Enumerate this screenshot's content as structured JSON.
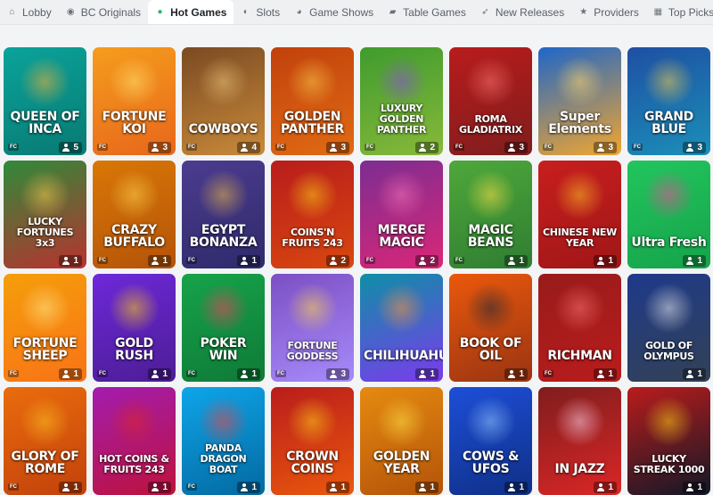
{
  "nav": {
    "items": [
      {
        "label": "Lobby",
        "icon": "home-icon",
        "glyph": "⌂",
        "active": false
      },
      {
        "label": "BC Originals",
        "icon": "bc-logo-icon",
        "glyph": "◉",
        "active": false
      },
      {
        "label": "Hot Games",
        "icon": "flame-icon",
        "glyph": "●",
        "active": true
      },
      {
        "label": "Slots",
        "icon": "slots-icon",
        "glyph": "◐",
        "active": false
      },
      {
        "label": "Game Shows",
        "icon": "game-shows-icon",
        "glyph": "◕",
        "active": false
      },
      {
        "label": "Table Games",
        "icon": "cards-icon",
        "glyph": "▰",
        "active": false
      },
      {
        "label": "New Releases",
        "icon": "rocket-icon",
        "glyph": "➶",
        "active": false
      },
      {
        "label": "Providers",
        "icon": "star-icon",
        "glyph": "★",
        "active": false
      },
      {
        "label": "Top Picks",
        "icon": "grid-icon",
        "glyph": "▦",
        "active": false
      },
      {
        "label": "",
        "icon": "more-icon",
        "glyph": "◈",
        "active": false
      }
    ]
  },
  "colors": {
    "accent": "#2bb673",
    "background": "#f3f4f6"
  },
  "games": [
    {
      "title": "QUEEN OF INCA",
      "provider": "FC",
      "players": "5",
      "bg": [
        "#0aa39a",
        "#087a73"
      ],
      "glow": "#f2b13a"
    },
    {
      "title": "FORTUNE KOI",
      "provider": "FC",
      "players": "3",
      "bg": [
        "#f59d1d",
        "#e8661b"
      ],
      "glow": "#ffe06b"
    },
    {
      "title": "COWBOYS",
      "provider": "FC",
      "players": "4",
      "bg": [
        "#7a4a22",
        "#c98a3a"
      ],
      "glow": "#e8c27a"
    },
    {
      "title": "GOLDEN PANTHER",
      "provider": "FC",
      "players": "3",
      "bg": [
        "#c2410c",
        "#e06b14"
      ],
      "glow": "#f7c548"
    },
    {
      "title": "LUXURY GOLDEN PANTHER",
      "provider": "FC",
      "players": "2",
      "bg": [
        "#3f9b2e",
        "#88b93a"
      ],
      "glow": "#8a4fd6"
    },
    {
      "title": "ROMA GLADIATRIX",
      "provider": "FC",
      "players": "3",
      "bg": [
        "#b91c1c",
        "#7f1d1d"
      ],
      "glow": "#f87171"
    },
    {
      "title": "Super Elements",
      "provider": "FC",
      "players": "3",
      "bg": [
        "#1e66c9",
        "#f2a62e"
      ],
      "glow": "#ffd76a"
    },
    {
      "title": "GRAND BLUE",
      "provider": "FC",
      "players": "3",
      "bg": [
        "#1e4fa3",
        "#1b8fb8"
      ],
      "glow": "#f2c94c"
    },
    {
      "title": "LUCKY FORTUNES 3x3",
      "provider": "",
      "players": "1",
      "bg": [
        "#2f8a3a",
        "#b9322f"
      ],
      "glow": "#f2c94c"
    },
    {
      "title": "CRAZY BUFFALO",
      "provider": "FC",
      "players": "1",
      "bg": [
        "#d97706",
        "#b45309"
      ],
      "glow": "#fcd34d"
    },
    {
      "title": "EGYPT BONANZA",
      "provider": "FC",
      "players": "1",
      "bg": [
        "#4c3c8f",
        "#2e2a6b"
      ],
      "glow": "#e8b64a"
    },
    {
      "title": "COINS'N FRUITS 243",
      "provider": "",
      "players": "2",
      "bg": [
        "#b91c1c",
        "#d9480f"
      ],
      "glow": "#facc15"
    },
    {
      "title": "MERGE MAGIC",
      "provider": "FC",
      "players": "2",
      "bg": [
        "#7c2d92",
        "#db2777"
      ],
      "glow": "#f472b6"
    },
    {
      "title": "MAGIC BEANS",
      "provider": "FC",
      "players": "1",
      "bg": [
        "#4ea83a",
        "#2f7d32"
      ],
      "glow": "#fde047"
    },
    {
      "title": "CHINESE NEW YEAR",
      "provider": "",
      "players": "1",
      "bg": [
        "#c81e1e",
        "#a01717"
      ],
      "glow": "#fbbf24"
    },
    {
      "title": "Ultra Fresh",
      "provider": "",
      "players": "1",
      "bg": [
        "#22c55e",
        "#16a34a"
      ],
      "glow": "#ec4899"
    },
    {
      "title": "FORTUNE SHEEP",
      "provider": "FC",
      "players": "1",
      "bg": [
        "#f59e0b",
        "#f97316"
      ],
      "glow": "#fde68a"
    },
    {
      "title": "GOLD RUSH",
      "provider": "FC",
      "players": "1",
      "bg": [
        "#6d28d9",
        "#4c1d95"
      ],
      "glow": "#facc15"
    },
    {
      "title": "POKER WIN",
      "provider": "FC",
      "players": "1",
      "bg": [
        "#16a34a",
        "#0f7a37"
      ],
      "glow": "#f43f5e"
    },
    {
      "title": "FORTUNE GODDESS",
      "provider": "FC",
      "players": "3",
      "bg": [
        "#7c4fc4",
        "#a78bfa"
      ],
      "glow": "#fcd34d"
    },
    {
      "title": "CHILIHUAHUA",
      "provider": "",
      "players": "1",
      "bg": [
        "#0e8fa6",
        "#7c3aed"
      ],
      "glow": "#fb923c"
    },
    {
      "title": "BOOK OF OIL",
      "provider": "",
      "players": "1",
      "bg": [
        "#ea580c",
        "#9a3412"
      ],
      "glow": "#1f2937"
    },
    {
      "title": "RICHMAN",
      "provider": "FC",
      "players": "1",
      "bg": [
        "#991b1b",
        "#b91c1c"
      ],
      "glow": "#f87171"
    },
    {
      "title": "GOLD OF OLYMPUS",
      "provider": "",
      "players": "1",
      "bg": [
        "#1e3a8a",
        "#334155"
      ],
      "glow": "#e5e7eb"
    },
    {
      "title": "GLORY OF ROME",
      "provider": "FC",
      "players": "1",
      "bg": [
        "#ea6c0c",
        "#c2410c"
      ],
      "glow": "#fbbf24"
    },
    {
      "title": "HOT COINS & FRUITS 243",
      "provider": "",
      "players": "1",
      "bg": [
        "#a21caf",
        "#be123c"
      ],
      "glow": "#dc2626"
    },
    {
      "title": "PANDA DRAGON BOAT",
      "provider": "FC",
      "players": "1",
      "bg": [
        "#0ea5e9",
        "#0369a1"
      ],
      "glow": "#ef4444"
    },
    {
      "title": "CROWN COINS",
      "provider": "",
      "players": "1",
      "bg": [
        "#b91c1c",
        "#ea580c"
      ],
      "glow": "#facc15"
    },
    {
      "title": "GOLDEN YEAR",
      "provider": "",
      "players": "1",
      "bg": [
        "#e58a10",
        "#b45309"
      ],
      "glow": "#fde047"
    },
    {
      "title": "COWS & UFOS",
      "provider": "",
      "players": "1",
      "bg": [
        "#1d4ed8",
        "#0f2f86"
      ],
      "glow": "#93c5fd"
    },
    {
      "title": "IN JAZZ",
      "provider": "",
      "players": "1",
      "bg": [
        "#7f1d1d",
        "#dc2626"
      ],
      "glow": "#fbcfe8"
    },
    {
      "title": "LUCKY STREAK 1000",
      "provider": "",
      "players": "1",
      "bg": [
        "#b91c1c",
        "#111827"
      ],
      "glow": "#facc15"
    }
  ]
}
